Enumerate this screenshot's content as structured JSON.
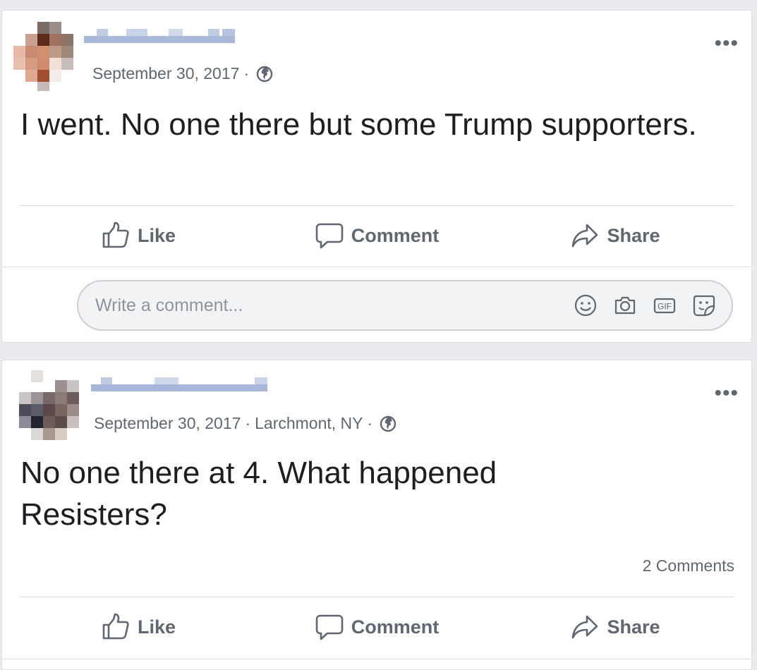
{
  "colors": {
    "page_bg": "#e9ebee",
    "card_bg": "#ffffff",
    "meta_text": "#616770",
    "action_text": "#606770",
    "body_text": "#1c1e21"
  },
  "posts": [
    {
      "date": "September 30, 2017",
      "location": "",
      "separator": "·",
      "privacy_icon": "globe-icon",
      "text": "I went. No one there but some Trump supporters.",
      "comment_count": "",
      "actions": {
        "like": "Like",
        "comment": "Comment",
        "share": "Share"
      },
      "composer": {
        "placeholder": "Write a comment...",
        "icons": [
          "emoji-icon",
          "camera-icon",
          "gif-icon",
          "sticker-icon"
        ]
      }
    },
    {
      "date": "September 30, 2017",
      "location": "Larchmont, NY",
      "separator": "·",
      "privacy_icon": "globe-icon",
      "text": "No one there at 4. What happened Resisters?",
      "comment_count": "2 Comments",
      "actions": {
        "like": "Like",
        "comment": "Comment",
        "share": "Share"
      }
    }
  ],
  "more_label": "•••"
}
